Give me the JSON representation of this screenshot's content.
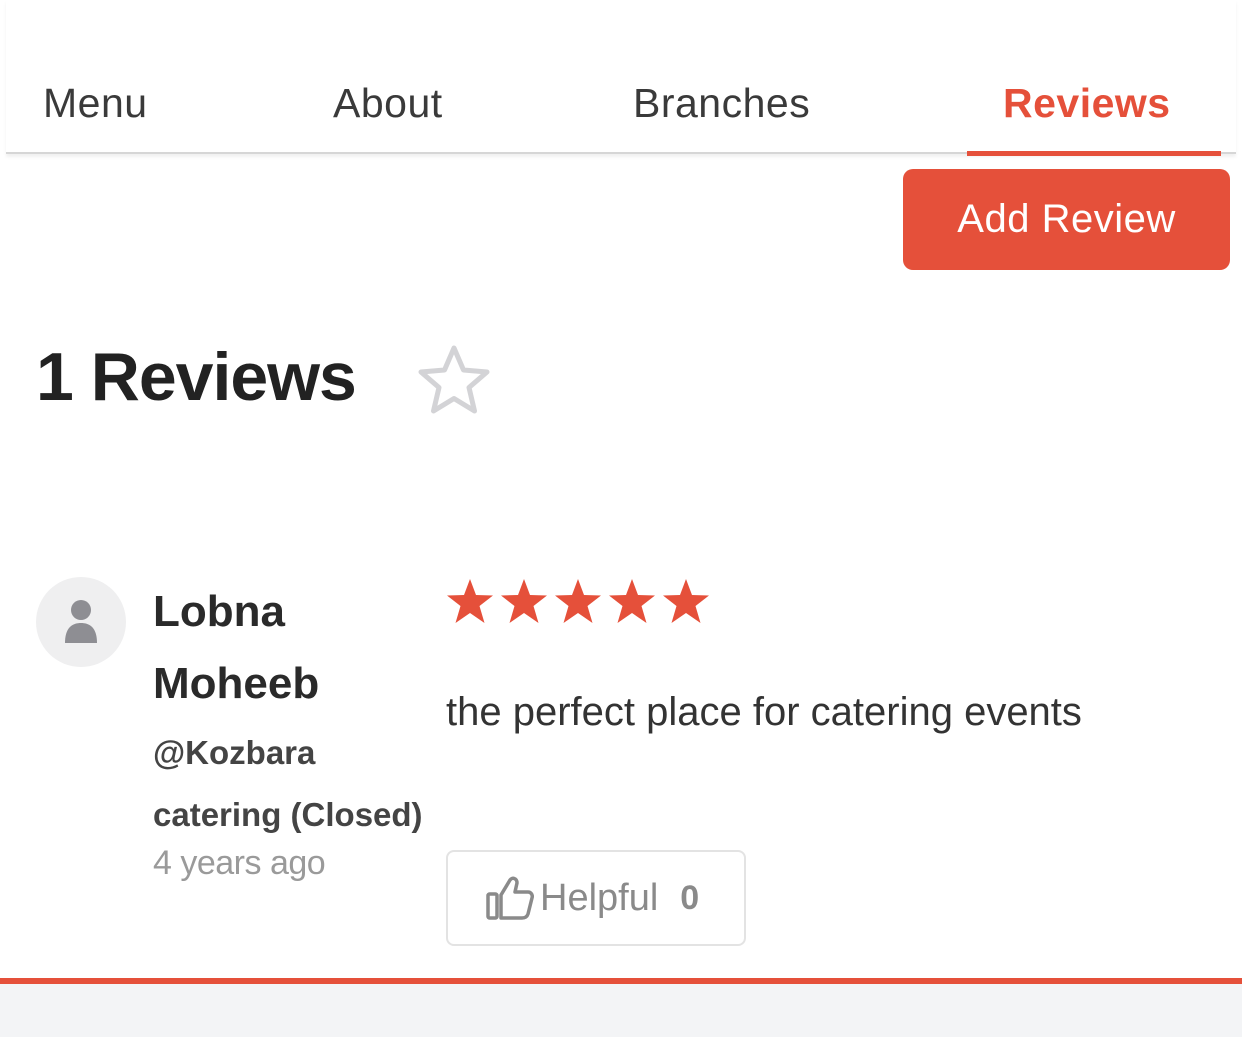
{
  "tabs": [
    {
      "label": "Menu"
    },
    {
      "label": "About"
    },
    {
      "label": "Branches"
    },
    {
      "label": "Reviews",
      "active": true
    }
  ],
  "actions": {
    "add_review_label": "Add Review"
  },
  "reviews_header": {
    "title": "1 Reviews",
    "favorite_icon": "star-outline-icon"
  },
  "review": {
    "reviewer_name": "Lobna Moheeb",
    "branch": "@Kozbara catering (Closed)",
    "time": "4 years ago",
    "rating": 5,
    "rating_max": 5,
    "text": "the perfect place for catering events",
    "helpful_label": "Helpful",
    "helpful_count": "0",
    "avatar_icon": "user-icon"
  },
  "colors": {
    "accent": "#e5503a",
    "text": "#2a2a2a",
    "muted": "#9a9a9a",
    "footer_bg": "#f3f4f6"
  }
}
